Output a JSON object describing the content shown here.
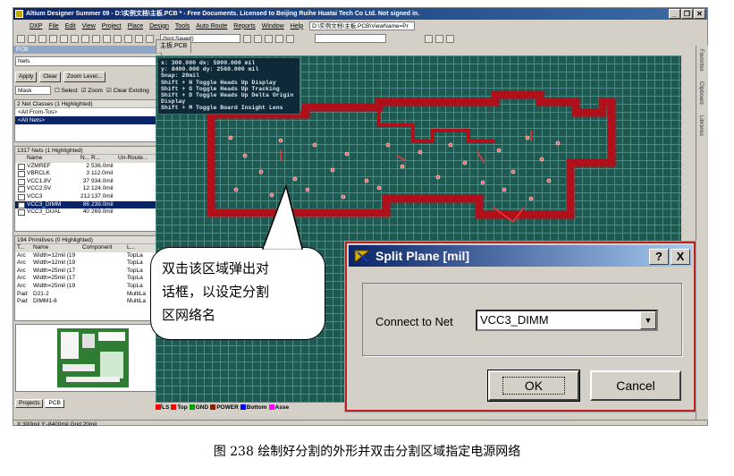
{
  "app": {
    "title": "Altium Designer Summer 09 - D:\\实例文档\\主板.PCB * - Free Documents. Licensed to Beijing Ruihe Huatai Tech Co Ltd. Not signed in.",
    "window_controls": [
      "_",
      "❐",
      "✕"
    ]
  },
  "menu": {
    "items": [
      "DXP",
      "File",
      "Edit",
      "View",
      "Project",
      "Place",
      "Design",
      "Tools",
      "Auto Route",
      "Reports",
      "Window",
      "Help"
    ],
    "path_combo": "D:\\实例文档\\主板.PCB\\ViewName=Pr",
    "saved_combo": "(Not Saved)"
  },
  "left_panel": {
    "title": "PCB",
    "mode_select": "Nets",
    "apply_label": "Apply",
    "clear_label": "Clear",
    "zoom_level_label": "Zoom Level...",
    "mask_select": "Mask",
    "select_label": "Select",
    "zoom_label": "Zoom",
    "clear_existing_label": "Clear Existing",
    "net_classes": {
      "header": "2 Net Classes (1 Highlighted)",
      "items": [
        "<All From-Tos>",
        "<All Nets>"
      ]
    },
    "nets": {
      "header": "1317 Nets (1 Highlighted)",
      "columns": [
        "Name",
        "N...",
        "R...",
        "Un-Route..."
      ],
      "rows": [
        {
          "name": "VZMREF",
          "n": "2",
          "r": "536.0mil"
        },
        {
          "name": "VBRCLK",
          "n": "3",
          "r": "112.0mil"
        },
        {
          "name": "VCC1.8V",
          "n": "37",
          "r": "934.0mil"
        },
        {
          "name": "VCC2.5V",
          "n": "12",
          "r": "124.0mil"
        },
        {
          "name": "VCC3",
          "n": "212",
          "r": "137.0mil"
        },
        {
          "name": "VCC3_DIMM",
          "n": "86",
          "r": "239.0mil"
        },
        {
          "name": "VCC3_DUAL",
          "n": "40",
          "r": "269.0mil"
        }
      ]
    },
    "primitives": {
      "header": "194 Primitives (0 Highlighted)",
      "columns": [
        "T...",
        "Name",
        "Component",
        "L..."
      ],
      "rows": [
        {
          "type": "Arc",
          "name": "Width=12mil (19",
          "comp": "",
          "layer": "TopLa"
        },
        {
          "type": "Arc",
          "name": "Width=12mil (19",
          "comp": "",
          "layer": "TopLa"
        },
        {
          "type": "Arc",
          "name": "Width=25mil (17",
          "comp": "",
          "layer": "TopLa"
        },
        {
          "type": "Arc",
          "name": "Width=25mil (17",
          "comp": "",
          "layer": "TopLa"
        },
        {
          "type": "Arc",
          "name": "Width=25mil (19",
          "comp": "",
          "layer": "TopLa"
        },
        {
          "type": "Pad",
          "name": "D21-2",
          "comp": "",
          "layer": "MultiLa"
        },
        {
          "type": "Pad",
          "name": "DIMM1-6",
          "comp": "",
          "layer": "MultiLa"
        }
      ]
    },
    "bottom_tabs": [
      "Projects",
      "PCB"
    ]
  },
  "document_tab": "主板.PCB",
  "hud": {
    "lines": [
      "x:  300.000   dx:  5900.000 mil",
      "y: 8400.000   dy:  2560.000 mil",
      "Snap: 20mil",
      "Shift + H  Toggle Heads Up Display",
      "Shift + G  Toggle Heads Up Tracking",
      "Shift + D  Toggle Heads Up Delta Origin Display",
      "Shift + M  Toggle Board Insight Lens"
    ]
  },
  "layers": [
    {
      "name": "LS",
      "color": "#ff0000"
    },
    {
      "name": "Top",
      "color": "#ff0000"
    },
    {
      "name": "GND",
      "color": "#00a000"
    },
    {
      "name": "POWER",
      "color": "#8b2000"
    },
    {
      "name": "Bottom",
      "color": "#0000ff"
    },
    {
      "name": "Asse",
      "color": "#ff00ff"
    }
  ],
  "status_bar": "X:300mil Y:-8400mil   Grid:20mil",
  "right_strip": [
    "Favorites",
    "Clipboard",
    "Libraries"
  ],
  "callout": {
    "text_line1": "双击该区域弹出对",
    "text_line2": "话框，以设定分割",
    "text_line3": "区网络名"
  },
  "dialog": {
    "title": "Split Plane [mil]",
    "help_btn": "?",
    "close_btn": "X",
    "connect_label": "Connect to Net",
    "net_value": "VCC3_DIMM",
    "ok_label": "OK",
    "cancel_label": "Cancel"
  },
  "caption": "图 238 绘制好分割的外形并双击分割区域指定电源网络"
}
